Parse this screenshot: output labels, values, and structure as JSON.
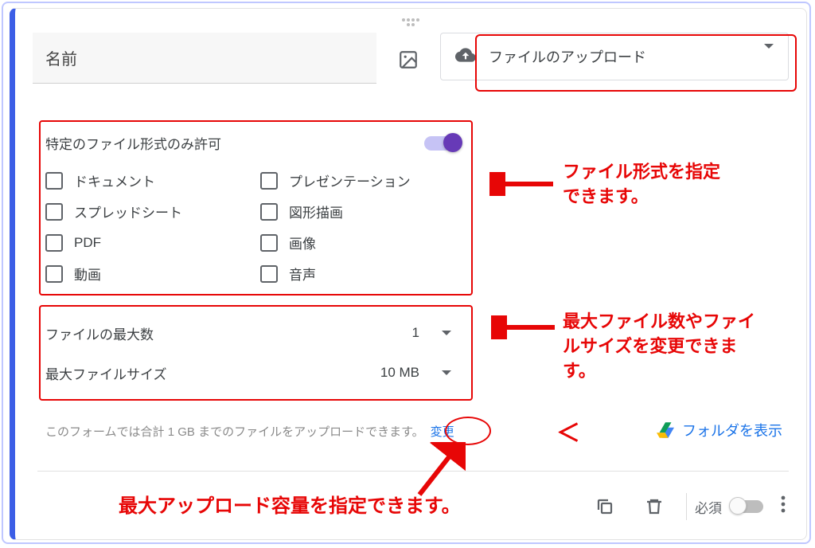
{
  "question": {
    "title": "名前"
  },
  "typeDropdown": {
    "label": "ファイルのアップロード"
  },
  "fileTypes": {
    "toggleLabel": "特定のファイル形式のみ許可",
    "items": [
      {
        "label": "ドキュメント"
      },
      {
        "label": "プレゼンテーション"
      },
      {
        "label": "スプレッドシート"
      },
      {
        "label": "図形描画"
      },
      {
        "label": "PDF"
      },
      {
        "label": "画像"
      },
      {
        "label": "動画"
      },
      {
        "label": "音声"
      }
    ]
  },
  "maxes": {
    "maxFilesLabel": "ファイルの最大数",
    "maxFilesValue": "1",
    "maxSizeLabel": "最大ファイルサイズ",
    "maxSizeValue": "10 MB"
  },
  "info": {
    "text": "このフォームでは合計 1 GB までのファイルをアップロードできます。",
    "changeLabel": "変更"
  },
  "folderLink": "フォルダを表示",
  "footer": {
    "requiredLabel": "必須"
  },
  "annotations": {
    "a1": "ファイル形式を指定\nできます。",
    "a2": "最大ファイル数やファイ\nルサイズを変更できま\nす。",
    "a3": "最大アップロード容量を指定できます。"
  }
}
